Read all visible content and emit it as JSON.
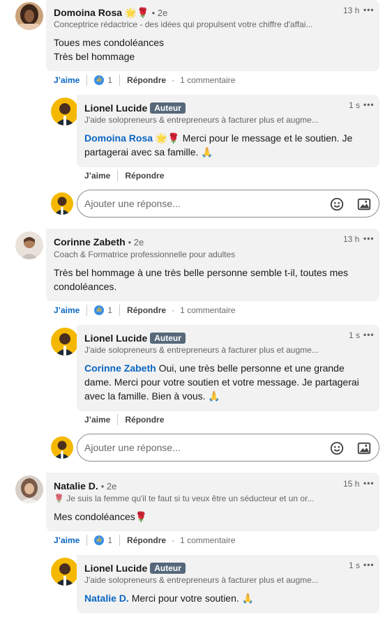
{
  "comments": [
    {
      "author": "Domoina Rosa",
      "emoji": "🌟🌹",
      "degree": "• 2e",
      "headline": "Conceptrice rédactrice - des idées qui propulsent votre chiffre d'affai...",
      "time": "13 h",
      "more": "•••",
      "text1": "Toues mes condoléances",
      "text2": "Très bel hommage",
      "like": "J’aime",
      "reaction_count": "1",
      "reply": "Répondre",
      "comments_count": "1 commentaire",
      "reply_item": {
        "author": "Lionel Lucide",
        "badge": "Auteur",
        "headline": "J'aide solopreneurs & entrepreneurs à facturer plus et augme...",
        "time": "1 s",
        "mention": "Domoina Rosa",
        "mention_emoji": "🌟🌹",
        "text": "Merci pour le message et le soutien. Je partagerai avec sa famille. 🙏",
        "like": "J’aime",
        "reply": "Répondre"
      }
    },
    {
      "author": "Corinne Zabeth",
      "degree": "• 2e",
      "headline": "Coach & Formatrice professionnelle pour adultes",
      "time": "13 h",
      "more": "•••",
      "text1": "Très bel hommage à une très belle personne semble t-il, toutes mes condoléances.",
      "like": "J’aime",
      "reaction_count": "1",
      "reply": "Répondre",
      "comments_count": "1 commentaire",
      "reply_item": {
        "author": "Lionel Lucide",
        "badge": "Auteur",
        "headline": "J'aide solopreneurs & entrepreneurs à facturer plus et augme...",
        "time": "1 s",
        "mention": "Corinne Zabeth",
        "text": "Oui, une très belle personne et une grande dame. Merci pour votre soutien et votre message. Je partagerai avec la famille. Bien à vous. 🙏",
        "like": "J’aime",
        "reply": "Répondre"
      }
    },
    {
      "author": "Natalie D.",
      "degree": "• 2e",
      "headline": "🌹 Je suis la femme qu'il te faut si tu veux être un séducteur et un or...",
      "time": "15 h",
      "more": "•••",
      "text1": "Mes condoléances🌹",
      "like": "J’aime",
      "reaction_count": "1",
      "reply": "Répondre",
      "comments_count": "1 commentaire",
      "reply_item": {
        "author": "Lionel Lucide",
        "badge": "Auteur",
        "headline": "J'aide solopreneurs & entrepreneurs à facturer plus et augme...",
        "time": "1 s",
        "mention": "Natalie D.",
        "text": "Merci pour votre soutien. 🙏"
      }
    }
  ],
  "reply_input": {
    "placeholder": "Ajouter une réponse..."
  },
  "colors": {
    "link": "#0a66c2",
    "bubble": "#f2f2f2",
    "badge": "#56687a"
  }
}
